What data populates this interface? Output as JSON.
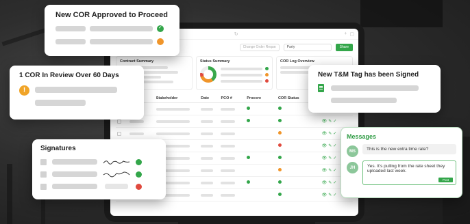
{
  "toolbar": {
    "search_text": "Change Order Request",
    "filter_value": "Party",
    "share_label": "Share"
  },
  "summary": {
    "contract_title": "Contract Summary",
    "status_title": "Status Summary",
    "log_title": "COR Log Overview"
  },
  "table": {
    "headers": [
      "COR #",
      "Stakeholder",
      "Date",
      "PCO #",
      "Procore",
      "COR Status",
      "Actions"
    ],
    "rows": [
      {
        "procore": "ok",
        "status": "ok"
      },
      {
        "procore": "ok",
        "status": "ok"
      },
      {
        "procore": "",
        "status": "warn"
      },
      {
        "procore": "",
        "status": "bad"
      },
      {
        "procore": "ok",
        "status": "ok"
      },
      {
        "procore": "",
        "status": "warn"
      },
      {
        "procore": "ok",
        "status": "ok"
      },
      {
        "procore": "",
        "status": "ok"
      }
    ]
  },
  "cards": {
    "approved": {
      "title": "New COR Approved to Proceed"
    },
    "review": {
      "title": "1 COR In Review Over 60 Days"
    },
    "signatures": {
      "title": "Signatures"
    },
    "tm_tag": {
      "title": "New T&M Tag has been Signed"
    },
    "messages": {
      "title": "Messages",
      "items": [
        {
          "initials": "MS",
          "text": "This is the new extra time rate?"
        },
        {
          "initials": "JH",
          "text": "Yes. It's pulling from the rate sheet they uploaded last week."
        }
      ],
      "post_label": "Post"
    }
  },
  "colors": {
    "accent": "#33a64a",
    "warning": "#f0952a",
    "danger": "#e04a3e"
  }
}
